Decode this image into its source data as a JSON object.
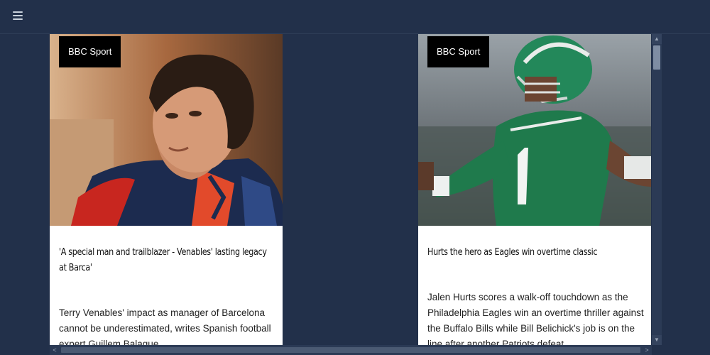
{
  "header": {
    "menu_icon": "hamburger-menu-icon"
  },
  "cards": [
    {
      "source": "BBC Sport",
      "title": "'A special man and trailblazer - Venables' lasting legacy at Barca'",
      "description": "Terry Venables' impact as manager of Barcelona cannot be underestimated, writes Spanish football expert Guillem Balague."
    },
    {
      "source": "BBC Sport",
      "title": "Hurts the hero as Eagles win overtime classic",
      "description": "Jalen Hurts scores a walk-off touchdown as the Philadelphia Eagles win an overtime thriller against the Buffalo Bills while Bill Belichick's job is on the line after another Patriots defeat."
    }
  ],
  "colors": {
    "background": "#22304a",
    "card": "#ffffff",
    "badge": "#000000",
    "eagles_green": "#1f7a4c"
  }
}
